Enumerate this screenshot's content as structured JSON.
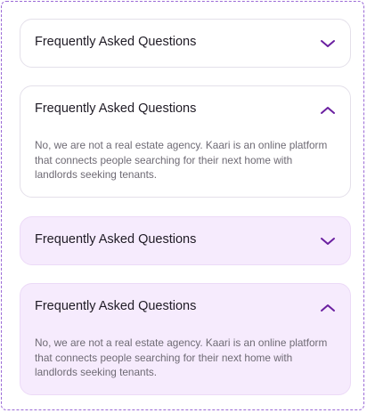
{
  "faqs": [
    {
      "question": "Frequently Asked Questions",
      "expanded": false,
      "answer": "",
      "toggle_icon": "chevron-down-icon"
    },
    {
      "question": "Frequently Asked Questions",
      "expanded": true,
      "answer": "No, we are not a real estate agency. Kaari is an online platform that connects people searching for their next home with landlords seeking tenants.",
      "toggle_icon": "chevron-up-icon"
    },
    {
      "question": "Frequently Asked Questions",
      "expanded": false,
      "answer": "",
      "toggle_icon": "chevron-down-icon"
    },
    {
      "question": "Frequently Asked Questions",
      "expanded": true,
      "answer": "No, we are not a real estate agency. Kaari is an online platform that connects people searching for their next home with landlords seeking tenants.",
      "toggle_icon": "chevron-up-icon"
    }
  ],
  "colors": {
    "accent": "#6a1fa0",
    "tinted_background": "#f6ebfd",
    "border_dashed": "#9b6ad6"
  }
}
